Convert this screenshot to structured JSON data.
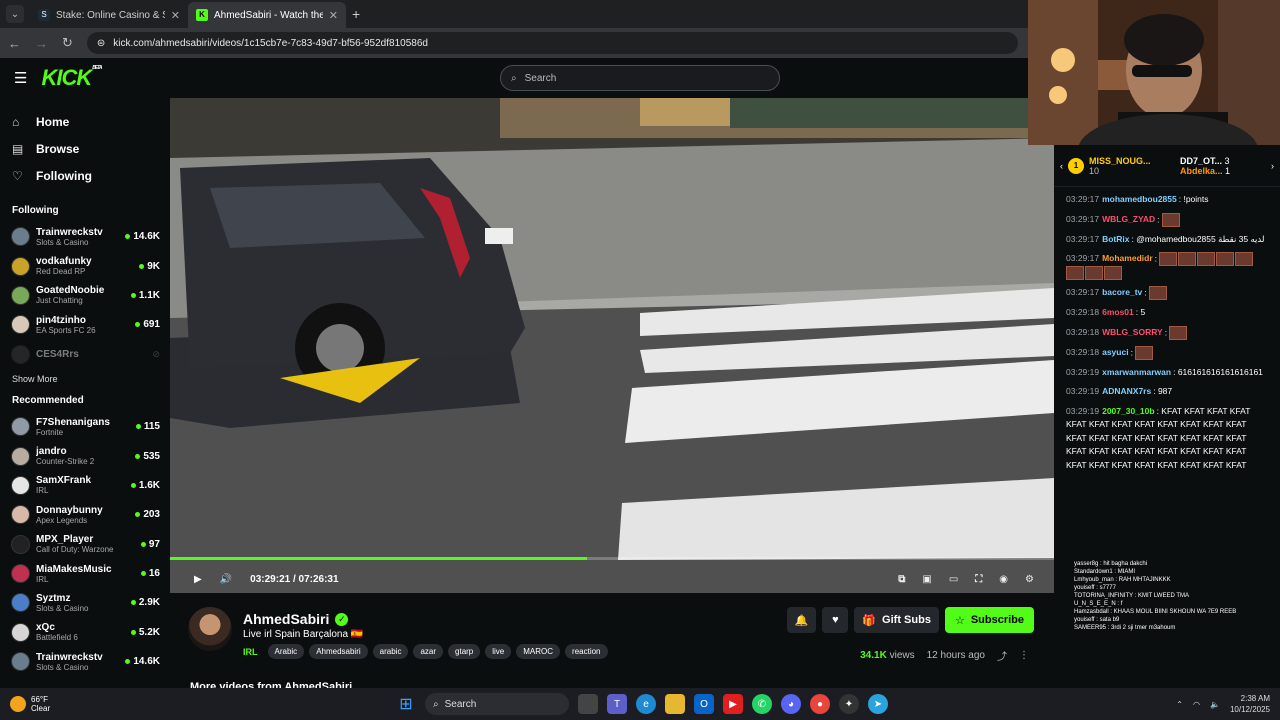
{
  "browser": {
    "tabs": [
      {
        "title": "Stake: Online Casino & Sports B",
        "active": false
      },
      {
        "title": "AhmedSabiri - Watch the VOD",
        "active": true
      }
    ],
    "url": "kick.com/ahmedsabiri/videos/1c15cb7e-7c83-49d7-bf56-952df810586d"
  },
  "header": {
    "logo": "KICK",
    "logo_badge": "BETA",
    "search_placeholder": "Search"
  },
  "sidebar": {
    "nav": [
      {
        "label": "Home",
        "icon": "home-icon"
      },
      {
        "label": "Browse",
        "icon": "browse-icon"
      },
      {
        "label": "Following",
        "icon": "heart-icon"
      }
    ],
    "following_title": "Following",
    "following": [
      {
        "name": "Trainwreckstv",
        "category": "Slots & Casino",
        "viewers": "14.6K",
        "color": "#6a7d8c"
      },
      {
        "name": "vodkafunky",
        "category": "Red Dead RP",
        "viewers": "9K",
        "color": "#c9a227"
      },
      {
        "name": "GoatedNoobie",
        "category": "Just Chatting",
        "viewers": "1.1K",
        "color": "#7aa85a"
      },
      {
        "name": "pin4tzinho",
        "category": "EA Sports FC 26",
        "viewers": "691",
        "color": "#d8c8b8"
      },
      {
        "name": "CES4Rrs",
        "category": "",
        "viewers": "",
        "color": "#444"
      }
    ],
    "show_more": "Show More",
    "recommended_title": "Recommended",
    "recommended": [
      {
        "name": "F7Shenanigans",
        "category": "Fortnite",
        "viewers": "115",
        "color": "#8f9aa6"
      },
      {
        "name": "jandro",
        "category": "Counter-Strike 2",
        "viewers": "535",
        "color": "#b8aba0"
      },
      {
        "name": "SamXFrank",
        "category": "IRL",
        "viewers": "1.6K",
        "color": "#e5e5e5"
      },
      {
        "name": "Donnaybunny",
        "category": "Apex Legends",
        "viewers": "203",
        "color": "#d8b8a8"
      },
      {
        "name": "MPX_Player",
        "category": "Call of Duty: Warzone",
        "viewers": "97",
        "color": "#222"
      },
      {
        "name": "MiaMakesMusic",
        "category": "IRL",
        "viewers": "16",
        "color": "#c03050"
      },
      {
        "name": "Syztmz",
        "category": "Slots & Casino",
        "viewers": "2.9K",
        "color": "#4a7ec9"
      },
      {
        "name": "xQc",
        "category": "Battlefield 6",
        "viewers": "5.2K",
        "color": "#d6d6d6"
      },
      {
        "name": "Trainwreckstv",
        "category": "Slots & Casino",
        "viewers": "14.6K",
        "color": "#6a7d8c"
      }
    ]
  },
  "player": {
    "time": "03:29:21 / 07:26:31",
    "progress_fraction": 0.472
  },
  "stream": {
    "streamer": "AhmedSabiri",
    "title": "Live irl Spain Barçalona 🇪🇸",
    "category": "IRL",
    "tags": [
      "Arabic",
      "Ahmedsabiri",
      "arabic",
      "azar",
      "gtarp",
      "live",
      "MAROC",
      "reaction"
    ],
    "gift_label": "Gift Subs",
    "subscribe_label": "Subscribe",
    "views": "34.1K",
    "views_label": "views",
    "ago": "12 hours ago",
    "more_videos": "More videos from AhmedSabiri"
  },
  "chat": {
    "pinned": [
      {
        "name": "MISS_NOUG...",
        "count": "10"
      },
      {
        "name": "DD7_OT...",
        "count": "3"
      },
      {
        "name": "Abdelka...",
        "count": "1"
      }
    ],
    "messages": [
      {
        "ts": "03:29:17",
        "user": "mohamedbou2855",
        "color": "#7fd0ff",
        "text": "!points",
        "emotes": 0
      },
      {
        "ts": "03:29:17",
        "user": "WBLG_ZYAD",
        "color": "#ff4d6d",
        "text": "",
        "emotes": 1
      },
      {
        "ts": "03:29:17",
        "user": "BotRix",
        "color": "#7fd0ff",
        "text": "@mohamedbou2855 لديه 35 نقطة",
        "emotes": 0
      },
      {
        "ts": "03:29:17",
        "user": "Mohamedidr",
        "color": "#ff9d2e",
        "text": "",
        "emotes": 8
      },
      {
        "ts": "03:29:17",
        "user": "bacore_tv",
        "color": "#7fd0ff",
        "text": "",
        "emotes": 1
      },
      {
        "ts": "03:29:18",
        "user": "6mos01",
        "color": "#ff4d6d",
        "text": "5",
        "emotes": 0
      },
      {
        "ts": "03:29:18",
        "user": "WBLG_SORRY",
        "color": "#ff4d6d",
        "text": "",
        "emotes": 1
      },
      {
        "ts": "03:29:18",
        "user": "asyuci",
        "color": "#7fd0ff",
        "text": "",
        "emotes": 1
      },
      {
        "ts": "03:29:19",
        "user": "xmarwanmarwan",
        "color": "#7fd0ff",
        "text": "616161616161616161",
        "emotes": 0
      },
      {
        "ts": "03:29:19",
        "user": "ADNANX7rs",
        "color": "#7fd0ff",
        "text": "987",
        "emotes": 0
      },
      {
        "ts": "03:29:19",
        "user": "2007_30_10b",
        "color": "#53fc18",
        "text": "KFAT KFAT KFAT KFAT KFAT KFAT KFAT KFAT KFAT KFAT KFAT KFAT KFAT KFAT KFAT KFAT KFAT KFAT KFAT KFAT KFAT KFAT KFAT KFAT KFAT KFAT KFAT KFAT KFAT KFAT KFAT KFAT KFAT KFAT KFAT KFAT",
        "emotes": 0
      }
    ],
    "overlay_lines": [
      "yasser8g : hit bagha dakchi",
      "Standardown1 : MIAMI",
      "Lmhyoub_man : RAH MHTAJINKKK",
      "youiseff : s7777",
      "TOTORINA_INFINITY : KMIT LWEED TMA",
      "U_N_S_E_E_N : f",
      "Hamzasbdall : KHAAS MOUL BIINI SKHOUN WA 7E9 REEB",
      "youiseff : sata b9",
      "SAMEER95 : 3rdi 2 sji tmer m3ahoum"
    ]
  },
  "taskbar": {
    "temp": "66°F",
    "condition": "Clear",
    "search": "Search",
    "time": "2:38 AM",
    "date": "10/12/2025"
  }
}
